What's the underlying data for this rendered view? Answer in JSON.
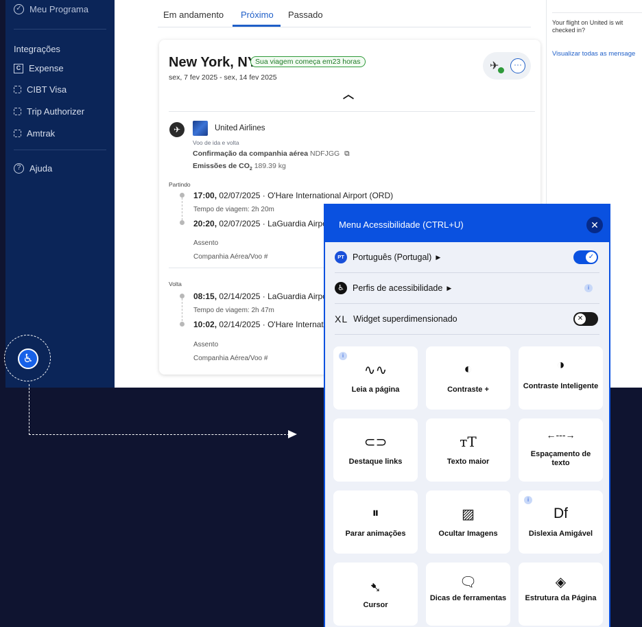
{
  "sidebar": {
    "top_item": "Meu Programa",
    "section": "Integrações",
    "items": [
      {
        "label": "Expense",
        "icon": "expense-icon"
      },
      {
        "label": "CIBT Visa",
        "icon": "integration-icon"
      },
      {
        "label": "Trip Authorizer",
        "icon": "integration-icon"
      },
      {
        "label": "Amtrak",
        "icon": "integration-icon"
      }
    ],
    "help": "Ajuda"
  },
  "tabs": [
    {
      "label": "Em andamento"
    },
    {
      "label": "Próximo",
      "active": true
    },
    {
      "label": "Passado"
    }
  ],
  "trip": {
    "title": "New York, NY",
    "badge": "Sua viagem começa em23 horas",
    "dates": "sex, 7 fev 2025 - sex, 14 fev 2025",
    "airline": "United Airlines",
    "trip_type": "Voo de ida e volta",
    "confirmation_label": "Confirmação da companhia aérea",
    "confirmation_code": "NDFJGG",
    "co2_label": "Emissões de CO",
    "co2_sub": "2",
    "co2_value": "189.39 kg",
    "departing": {
      "label": "Partindo",
      "dep_time": "17:00,",
      "dep_detail": "02/07/2025 · O'Hare International Airport (ORD)",
      "duration": "Tempo de viagem: 2h 20m",
      "arr_time": "20:20,",
      "arr_detail": "02/07/2025 · LaGuardia Airpo",
      "seat": "Assento",
      "flight": "Companhia Aérea/Voo #"
    },
    "returning": {
      "label": "Volta",
      "dep_time": "08:15,",
      "dep_detail": "02/14/2025 · LaGuardia Airpo",
      "duration": "Tempo de viagem: 2h 47m",
      "arr_time": "10:02,",
      "arr_detail": "02/14/2025 · O'Hare Internatio",
      "seat": "Assento",
      "flight": "Companhia Aérea/Voo #"
    }
  },
  "messages": {
    "text_line1": "Your flight on United is wit",
    "text_line2": "checked in?",
    "view_all": "Visualizar todas as mensage"
  },
  "accessibility_menu": {
    "title": "Menu Acessibilidade (CTRL+U)",
    "language_badge": "PT",
    "language": "Português (Portugal)",
    "profiles": "Perfis de acessibilidade",
    "oversized_prefix": "XL",
    "oversized": "Widget superdimensionado",
    "tiles": [
      {
        "label": "Leia a página",
        "icon": "waveform-icon",
        "info": true
      },
      {
        "label": "Contraste +",
        "icon": "contrast-icon"
      },
      {
        "label": "Contraste Inteligente",
        "icon": "smart-contrast-icon"
      },
      {
        "label": "Destaque links",
        "icon": "link-icon"
      },
      {
        "label": "Texto maior",
        "icon": "text-size-icon"
      },
      {
        "label": "Espaçamento de texto",
        "icon": "text-spacing-icon"
      },
      {
        "label": "Parar animações",
        "icon": "pause-animation-icon"
      },
      {
        "label": "Ocultar Imagens",
        "icon": "hide-image-icon"
      },
      {
        "label": "Dislexia Amigável",
        "icon": "dyslexia-icon",
        "info": true
      },
      {
        "label": "Cursor",
        "icon": "cursor-icon"
      },
      {
        "label": "Dicas de ferramentas",
        "icon": "tooltip-icon"
      },
      {
        "label": "Estrutura da Página",
        "icon": "page-structure-icon"
      }
    ]
  },
  "colors": {
    "sidebar_bg": "#0b2558",
    "accent_blue": "#0a51e0",
    "badge_green": "#2f9a3a",
    "page_bg": "#0f1430"
  }
}
